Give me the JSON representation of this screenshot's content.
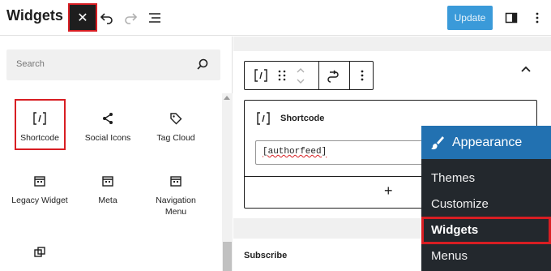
{
  "header": {
    "title": "Widgets",
    "update_label": "Update"
  },
  "search": {
    "placeholder": "Search"
  },
  "blocks": [
    {
      "label": "Shortcode",
      "icon": "shortcode-icon"
    },
    {
      "label": "Social Icons",
      "icon": "share-icon"
    },
    {
      "label": "Tag Cloud",
      "icon": "tag-icon"
    },
    {
      "label": "Legacy Widget",
      "icon": "calendar-widget-icon"
    },
    {
      "label": "Meta",
      "icon": "calendar-widget-icon"
    },
    {
      "label": "Navigation\nMenu",
      "icon": "calendar-widget-icon"
    },
    {
      "label": "",
      "icon": "duplicate-icon"
    }
  ],
  "editor": {
    "block_title": "Shortcode",
    "shortcode_value": "[authorfeed]",
    "next_area": "Subscribe"
  },
  "admin_menu": {
    "heading": "Appearance",
    "items": [
      "Themes",
      "Customize",
      "Widgets",
      "Menus"
    ]
  },
  "colors": {
    "highlight": "#d81e23",
    "update_button": "#3a9ad9",
    "admin_menu_bg": "#23282d",
    "admin_menu_active": "#2271b1"
  }
}
